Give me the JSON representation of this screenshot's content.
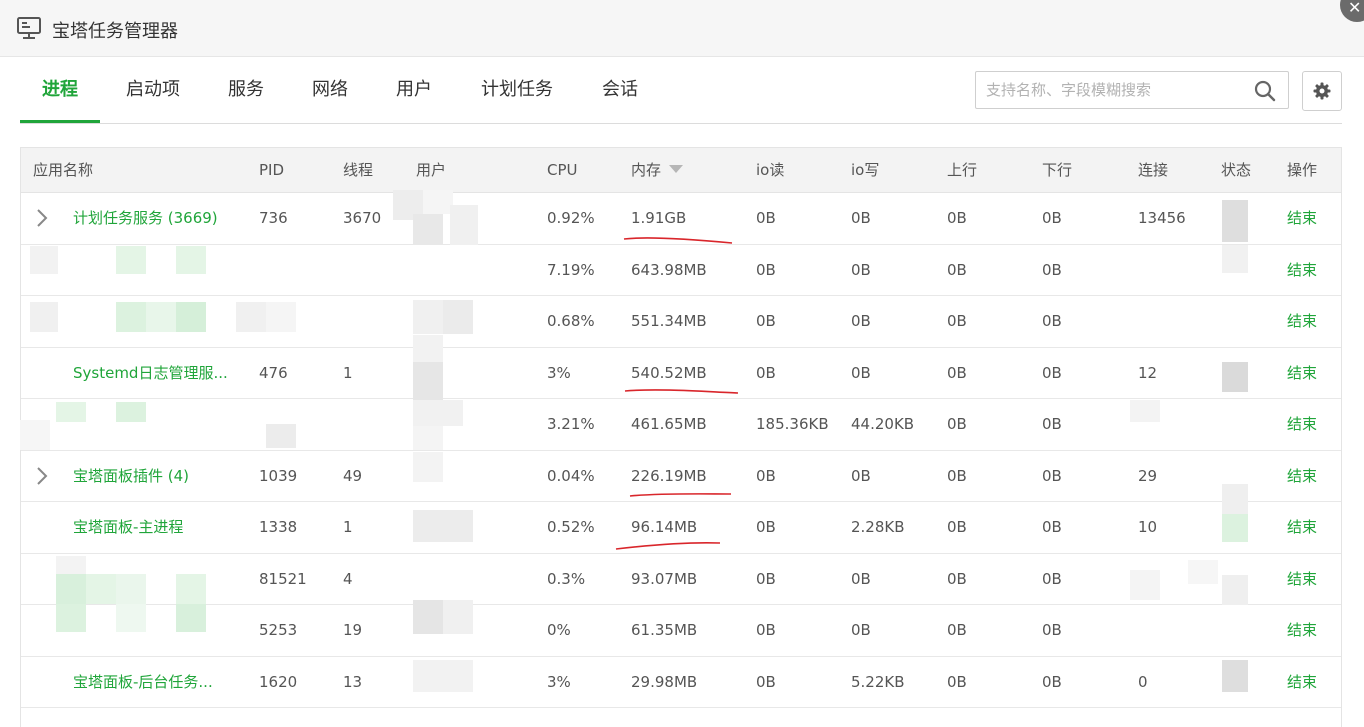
{
  "window": {
    "title": "宝塔任务管理器"
  },
  "tabs": [
    {
      "label": "进程",
      "active": true
    },
    {
      "label": "启动项"
    },
    {
      "label": "服务"
    },
    {
      "label": "网络"
    },
    {
      "label": "用户"
    },
    {
      "label": "计划任务"
    },
    {
      "label": "会话"
    }
  ],
  "search": {
    "placeholder": "支持名称、字段模糊搜索",
    "value": ""
  },
  "table": {
    "headers": {
      "name": "应用名称",
      "pid": "PID",
      "threads": "线程",
      "user": "用户",
      "cpu": "CPU",
      "mem": "内存",
      "io_read": "io读",
      "io_write": "io写",
      "up": "上行",
      "down": "下行",
      "conn": "连接",
      "status": "状态",
      "op": "操作"
    },
    "rows": [
      {
        "name": "计划任务服务 (3669)",
        "expandable": true,
        "pid": "736",
        "threads": "3670",
        "cpu": "0.92%",
        "mem": "1.91GB",
        "io_read": "0B",
        "io_write": "0B",
        "up": "0B",
        "down": "0B",
        "conn": "13456",
        "action": "结束"
      },
      {
        "name": "",
        "pid": "",
        "threads": "",
        "cpu": "7.19%",
        "mem": "643.98MB",
        "io_read": "0B",
        "io_write": "0B",
        "up": "0B",
        "down": "0B",
        "conn": "",
        "action": "结束"
      },
      {
        "name": "",
        "pid": "",
        "threads": "",
        "cpu": "0.68%",
        "mem": "551.34MB",
        "io_read": "0B",
        "io_write": "0B",
        "up": "0B",
        "down": "0B",
        "conn": "",
        "action": "结束"
      },
      {
        "name": "Systemd日志管理服...",
        "pid": "476",
        "threads": "1",
        "cpu": "3%",
        "mem": "540.52MB",
        "io_read": "0B",
        "io_write": "0B",
        "up": "0B",
        "down": "0B",
        "conn": "12",
        "action": "结束"
      },
      {
        "name": "",
        "pid": "",
        "threads": "",
        "cpu": "3.21%",
        "mem": "461.65MB",
        "io_read": "185.36KB",
        "io_write": "44.20KB",
        "up": "0B",
        "down": "0B",
        "conn": "",
        "action": "结束"
      },
      {
        "name": "宝塔面板插件 (4)",
        "expandable": true,
        "pid": "1039",
        "threads": "49",
        "cpu": "0.04%",
        "mem": "226.19MB",
        "io_read": "0B",
        "io_write": "0B",
        "up": "0B",
        "down": "0B",
        "conn": "29",
        "action": "结束"
      },
      {
        "name": "宝塔面板-主进程",
        "pid": "1338",
        "threads": "1",
        "cpu": "0.52%",
        "mem": "96.14MB",
        "io_read": "0B",
        "io_write": "2.28KB",
        "up": "0B",
        "down": "0B",
        "conn": "10",
        "action": "结束"
      },
      {
        "name": "",
        "pid": "81521",
        "threads": "4",
        "cpu": "0.3%",
        "mem": "93.07MB",
        "io_read": "0B",
        "io_write": "0B",
        "up": "0B",
        "down": "0B",
        "conn": "",
        "action": "结束"
      },
      {
        "name": "",
        "pid": "5253",
        "threads": "19",
        "cpu": "0%",
        "mem": "61.35MB",
        "io_read": "0B",
        "io_write": "0B",
        "up": "0B",
        "down": "0B",
        "conn": "",
        "action": "结束"
      },
      {
        "name": "宝塔面板-后台任务...",
        "pid": "1620",
        "threads": "13",
        "cpu": "3%",
        "mem": "29.98MB",
        "io_read": "0B",
        "io_write": "5.22KB",
        "up": "0B",
        "down": "0B",
        "conn": "0",
        "action": "结束"
      }
    ]
  },
  "colors": {
    "accent": "#20a53a",
    "annotation": "#d9262b"
  },
  "icons": {
    "app": "monitor-icon",
    "search": "search-icon",
    "settings": "gear-icon",
    "expand": "chevron-right-icon",
    "close": "close-icon",
    "sort": "sort-desc-icon"
  }
}
